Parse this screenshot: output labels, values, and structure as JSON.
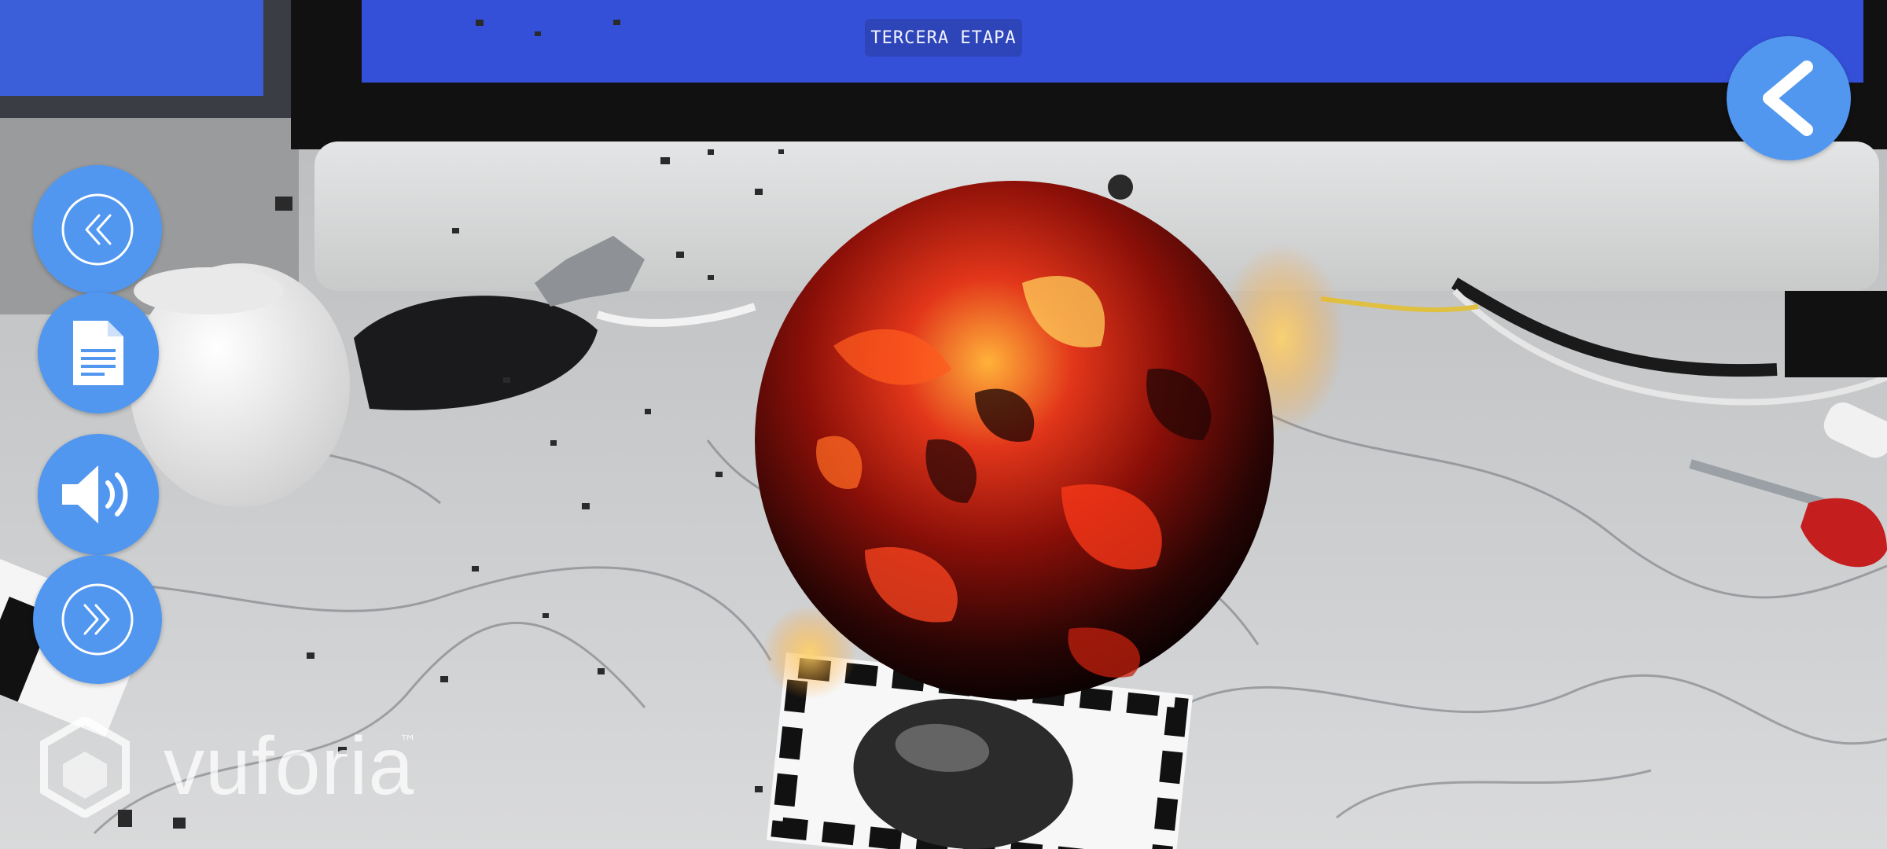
{
  "stage_title": "TERCERA ETAPA",
  "controls": {
    "back": {
      "icon": "chevron-left-icon",
      "color": "#5197f0"
    },
    "rewind": {
      "icon": "double-chevron-left-icon"
    },
    "document": {
      "icon": "document-icon"
    },
    "sound": {
      "icon": "speaker-icon"
    },
    "forward": {
      "icon": "double-chevron-right-icon"
    }
  },
  "watermark": {
    "text": "vuforia",
    "tm": "™"
  },
  "colors": {
    "button_blue": "#5197f0",
    "screen_blue": "#3550d8"
  }
}
